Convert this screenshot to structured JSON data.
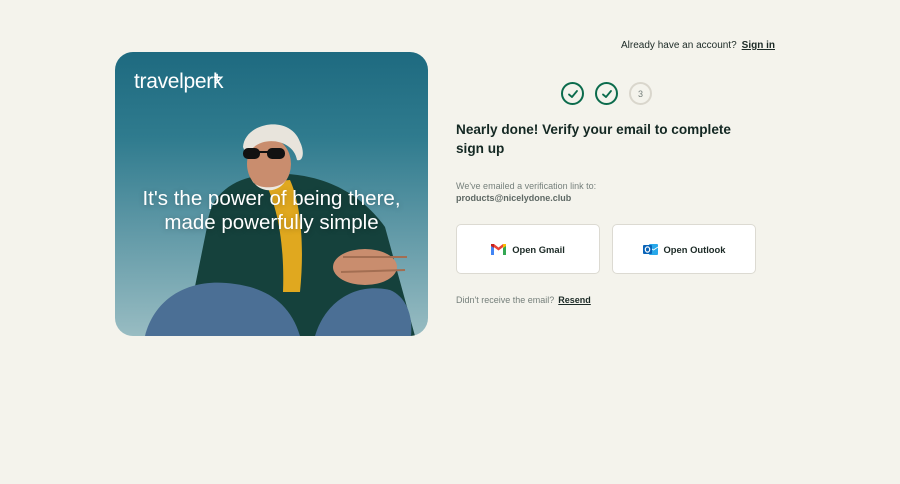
{
  "brand": {
    "name": "travelperk",
    "plus": "+"
  },
  "hero": {
    "tagline_line1": "It's the power of being there,",
    "tagline_line2": "made powerfully simple"
  },
  "header": {
    "account_prompt": "Already have an account?",
    "signin_label": "Sign in"
  },
  "stepper": {
    "steps": [
      {
        "state": "done",
        "label": ""
      },
      {
        "state": "done",
        "label": ""
      },
      {
        "state": "current",
        "label": "3"
      }
    ]
  },
  "main": {
    "heading": "Nearly done! Verify your email to complete sign up",
    "subtext": "We've emailed a verification link to:",
    "email": "products@nicelydone.club",
    "buttons": {
      "gmail_label": "Open Gmail",
      "gmail_icon": "gmail-icon",
      "outlook_label": "Open Outlook",
      "outlook_icon": "outlook-icon"
    },
    "resend_prompt": "Didn't receive the email?",
    "resend_label": "Resend"
  },
  "colors": {
    "background": "#f4f3ec",
    "accent_green": "#0b6b4c",
    "text_dark": "#142823",
    "text_muted": "#76807c"
  }
}
